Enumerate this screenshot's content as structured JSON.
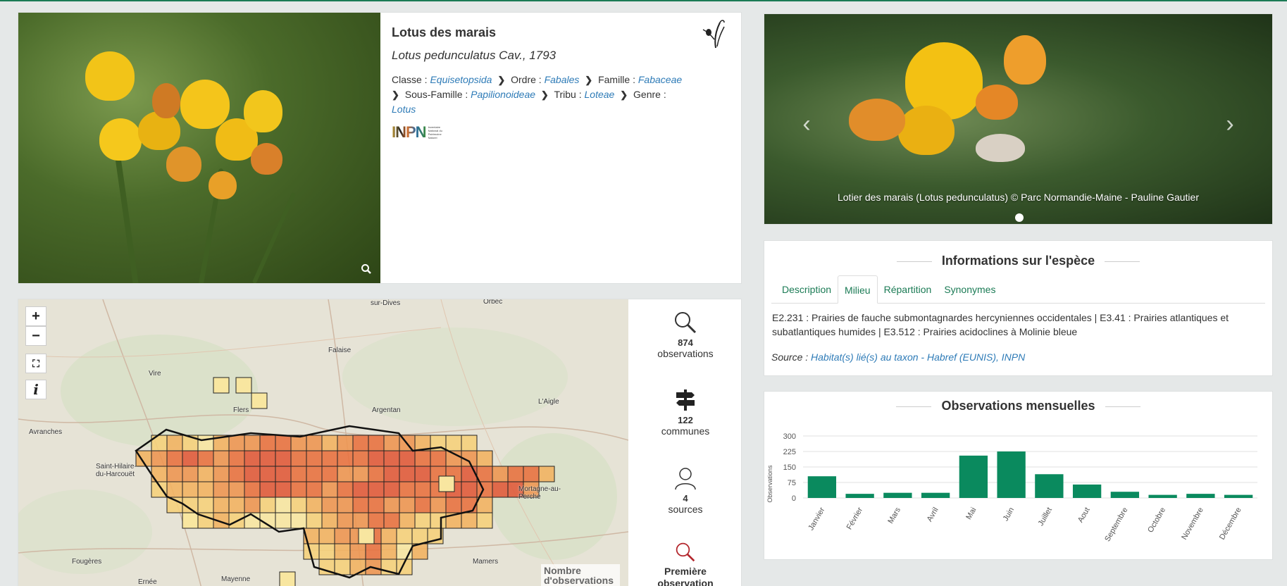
{
  "species": {
    "common_name": "Lotus des marais",
    "scientific_name": "Lotus pedunculatus Cav., 1793",
    "taxonomy": {
      "classe_label": "Classe :",
      "classe": "Equisetopsida",
      "ordre_label": "Ordre :",
      "ordre": "Fabales",
      "famille_label": "Famille :",
      "famille": "Fabaceae",
      "sous_famille_label": "Sous-Famille :",
      "sous_famille": "Papilionoideae",
      "tribu_label": "Tribu :",
      "tribu": "Loteae",
      "genre_label": "Genre :",
      "genre": "Lotus"
    },
    "logo": {
      "letters": "INPN",
      "subtext": "Inventaire National du Patrimoine Naturel"
    }
  },
  "carousel": {
    "caption": "Lotier des marais (Lotus pedunculatus) © Parc Normandie-Maine - Pauline Gautier",
    "prev_icon": "chevron-left-icon",
    "next_icon": "chevron-right-icon"
  },
  "info": {
    "title": "Informations sur l'espèce",
    "tabs": [
      "Description",
      "Milieu",
      "Répartition",
      "Synonymes"
    ],
    "active_tab": "Milieu",
    "habitat": "E2.231 : Prairies de fauche submontagnardes hercyniennes occidentales | E3.41 : Prairies atlantiques et subatlantiques humides | E3.512 : Prairies acidoclines à Molinie bleue",
    "source_label": "Source :",
    "source_text": "Habitat(s) lié(s) au taxon - Habref (EUNIS), INPN"
  },
  "chart_data": {
    "type": "bar",
    "title": "Observations mensuelles",
    "ylabel": "Observations",
    "xlabel": "",
    "ylim": [
      0,
      300
    ],
    "yticks": [
      0,
      75,
      150,
      225,
      300
    ],
    "categories": [
      "Janvier",
      "Février",
      "Mars",
      "Avril",
      "Mai",
      "Juin",
      "Juillet",
      "Aout",
      "Septembre",
      "Octobre",
      "Novembre",
      "Décembre"
    ],
    "values": [
      105,
      20,
      25,
      25,
      205,
      225,
      115,
      65,
      30,
      15,
      20,
      15
    ],
    "grid": true,
    "color": "#0a8a5e"
  },
  "map": {
    "zoom_in": "+",
    "zoom_out": "−",
    "legend": "Nombre d'observations",
    "places": [
      "sur-Dives",
      "Orbec",
      "Falaise",
      "Vire",
      "Flers",
      "Argentan",
      "L'Aigle",
      "Avranches",
      "Saint-Hilaire-du-Harcouët",
      "Mortagne-au-Perche",
      "Fougères",
      "Mayenne",
      "Ernée",
      "Mamers"
    ]
  },
  "stats": {
    "observations_count": "874",
    "observations_label": "observations",
    "communes_count": "122",
    "communes_label": "communes",
    "sources_count": "4",
    "sources_label": "sources",
    "first_obs_label": "Première observation"
  },
  "colors": {
    "accent": "#1b7b55",
    "link": "#2e7bb7",
    "bar": "#0a8a5e"
  }
}
